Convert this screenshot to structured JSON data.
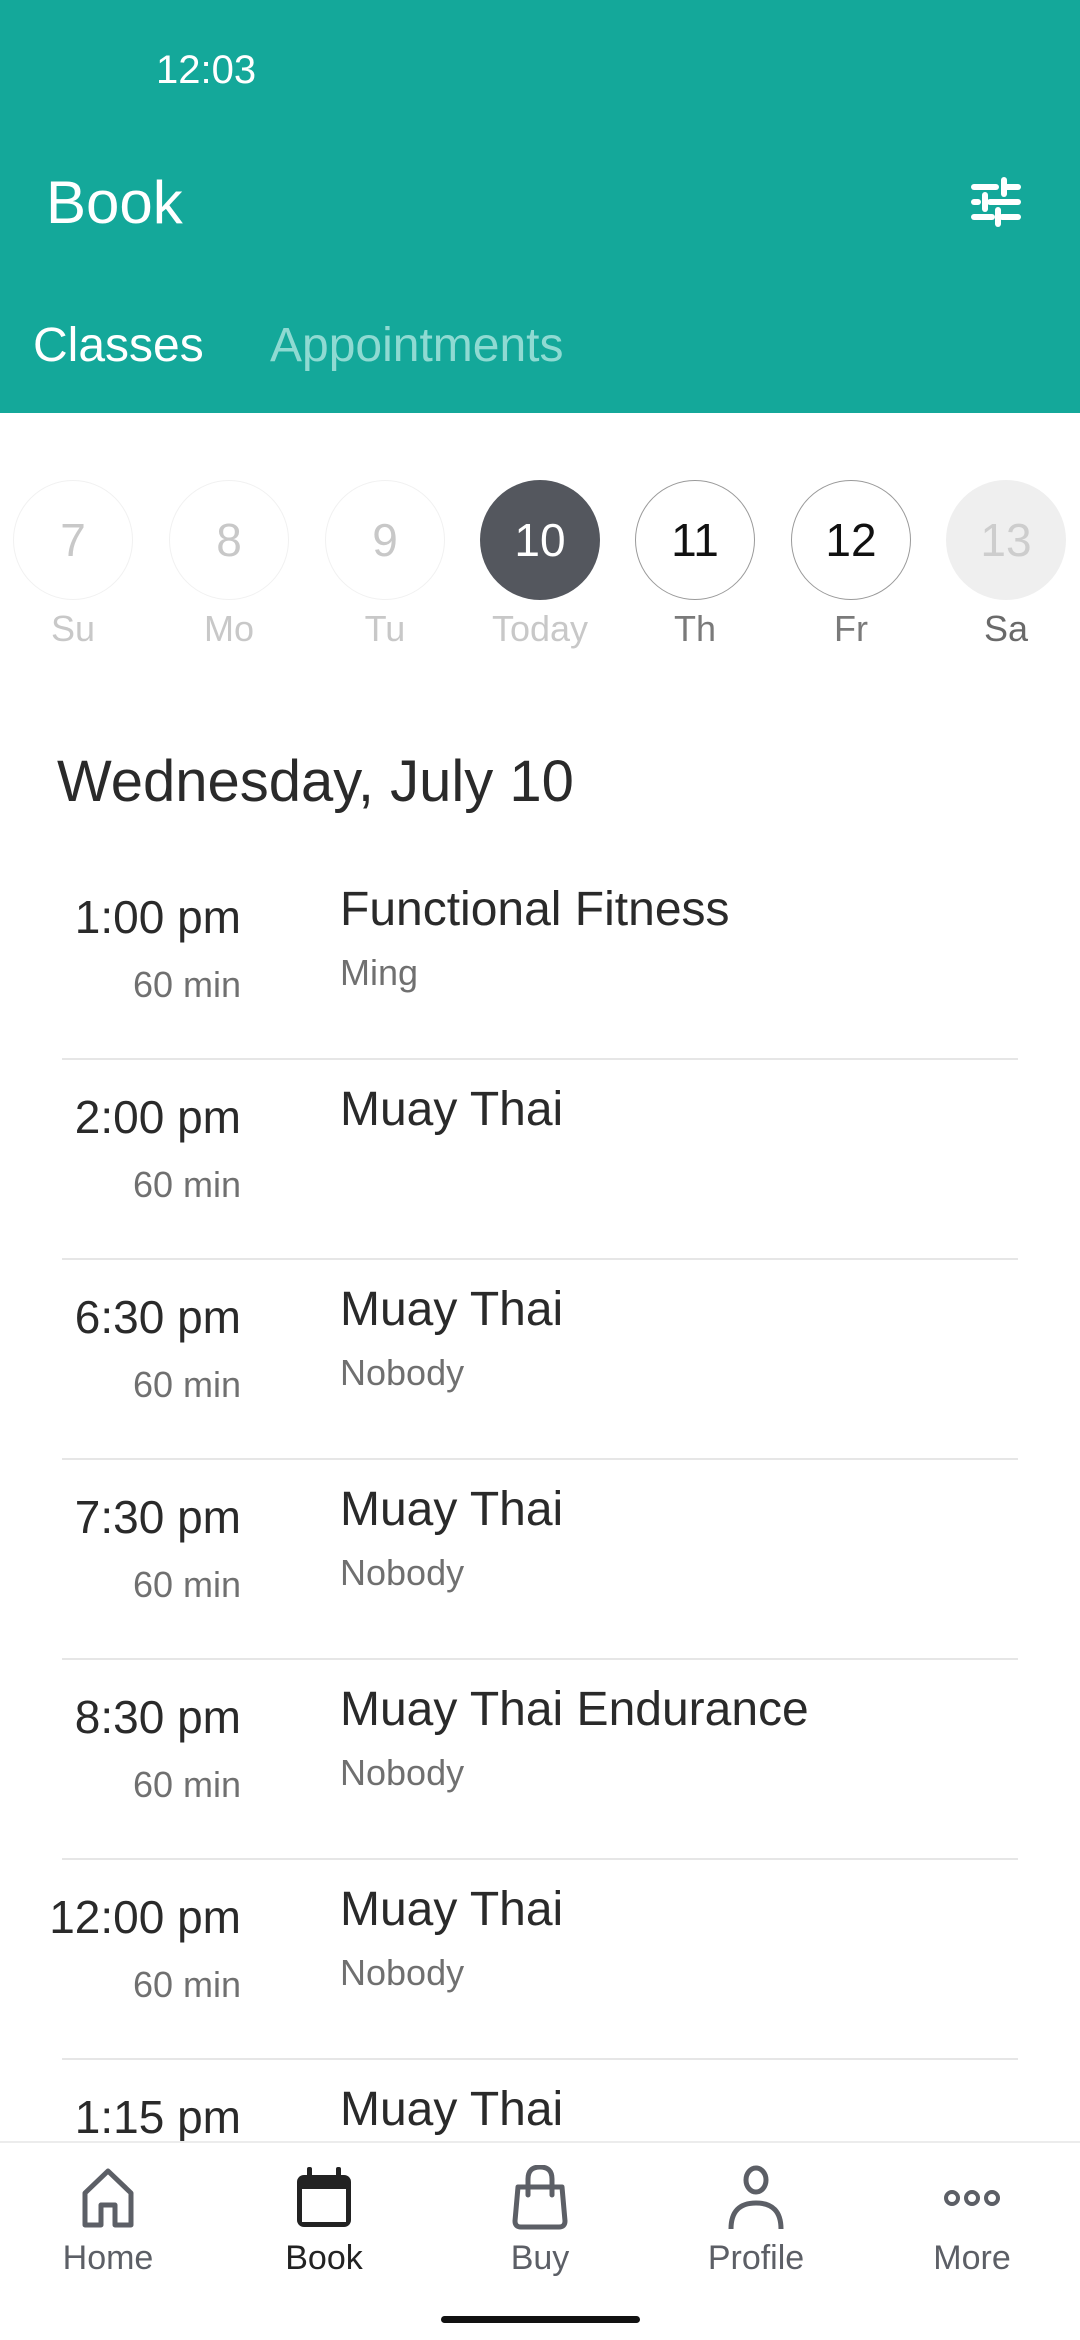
{
  "status_bar": {
    "time": "12:03"
  },
  "header": {
    "title": "Book",
    "filter_icon": "sliders-icon",
    "tabs": [
      {
        "label": "Classes",
        "active": true
      },
      {
        "label": "Appointments",
        "active": false
      }
    ],
    "accent_color": "#14a89a"
  },
  "week": [
    {
      "number": "7",
      "label": "Su",
      "state": "past"
    },
    {
      "number": "8",
      "label": "Mo",
      "state": "past"
    },
    {
      "number": "9",
      "label": "Tu",
      "state": "past"
    },
    {
      "number": "10",
      "label": "Today",
      "state": "selected"
    },
    {
      "number": "11",
      "label": "Th",
      "state": "future"
    },
    {
      "number": "12",
      "label": "Fr",
      "state": "future"
    },
    {
      "number": "13",
      "label": "Sa",
      "state": "closed"
    }
  ],
  "date_heading": "Wednesday, July 10",
  "classes": [
    {
      "time": "1:00 pm",
      "duration": "60 min",
      "name": "Functional Fitness",
      "instructor": "Ming"
    },
    {
      "time": "2:00 pm",
      "duration": "60 min",
      "name": "Muay Thai",
      "instructor": ""
    },
    {
      "time": "6:30 pm",
      "duration": "60 min",
      "name": "Muay Thai",
      "instructor": "Nobody"
    },
    {
      "time": "7:30 pm",
      "duration": "60 min",
      "name": "Muay Thai",
      "instructor": "Nobody"
    },
    {
      "time": "8:30 pm",
      "duration": "60 min",
      "name": "Muay Thai Endurance",
      "instructor": "Nobody"
    },
    {
      "time": "12:00 pm",
      "duration": "60 min",
      "name": "Muay Thai",
      "instructor": "Nobody"
    },
    {
      "time": "1:15 pm",
      "duration": "",
      "name": "Muay Thai",
      "instructor": ""
    }
  ],
  "bottom_nav": [
    {
      "label": "Home",
      "icon": "home-icon",
      "active": false
    },
    {
      "label": "Book",
      "icon": "calendar-icon",
      "active": true
    },
    {
      "label": "Buy",
      "icon": "shopping-bag-icon",
      "active": false
    },
    {
      "label": "Profile",
      "icon": "person-icon",
      "active": false
    },
    {
      "label": "More",
      "icon": "more-dots-icon",
      "active": false
    }
  ]
}
